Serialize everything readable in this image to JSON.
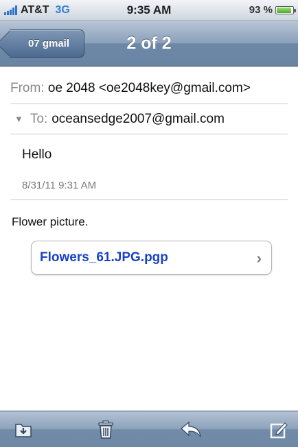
{
  "status_bar": {
    "carrier": "AT&T",
    "network": "3G",
    "time": "9:35 AM",
    "battery_text": "93 %",
    "battery_level_percent": 93
  },
  "nav": {
    "back_label": "07 gmail",
    "title": "2 of 2"
  },
  "email": {
    "from_label": "From:",
    "from_value": "oe 2048 <oe2048key@gmail.com>",
    "to_label": "To:",
    "to_value": "oceansedge2007@gmail.com",
    "subject": "Hello",
    "date": "8/31/11 9:31 AM",
    "body": "Flower picture.",
    "attachment": "Flowers_61.JPG.pgp"
  },
  "toolbar": {
    "icons": [
      "move-folder-icon",
      "trash-icon",
      "reply-icon",
      "compose-icon"
    ]
  },
  "colors": {
    "nav_bar": "#6d87a7",
    "attachment_link": "#1a42c9",
    "network": "#2f7fd6",
    "battery": "#4aa82a"
  }
}
